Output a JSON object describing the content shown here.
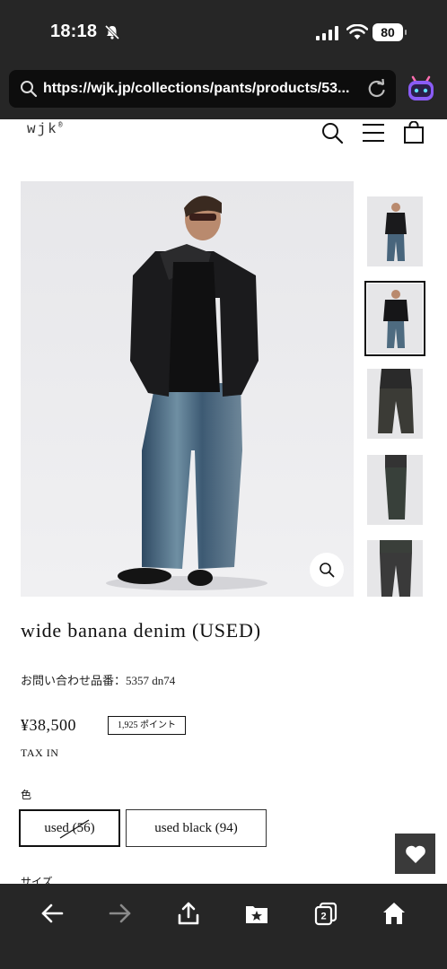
{
  "status_bar": {
    "time": "18:18",
    "battery": "80"
  },
  "browser": {
    "url": "https://wjk.jp/collections/pants/products/53..."
  },
  "site": {
    "logo": "wjk",
    "logo_mark": "®"
  },
  "product": {
    "title": "wide banana denim (USED)",
    "inquiry_number": "お問い合わせ品番：5357 dn74",
    "price": "¥38,500",
    "points": "1,925 ポイント",
    "tax": "TAX IN",
    "color_label": "色",
    "variants": [
      {
        "label": "used (56)",
        "selected": true,
        "sold_out": true
      },
      {
        "label": "used black (94)",
        "selected": false,
        "sold_out": false
      }
    ],
    "size_label": "サイズ",
    "thumbnail_count": 5,
    "selected_thumbnail": 2
  },
  "toolbar": {
    "tab_count": "2"
  },
  "colors": {
    "chrome": "#262626",
    "url_field": "#0d0d0d",
    "assistant_accent": "#8a5cf6"
  }
}
